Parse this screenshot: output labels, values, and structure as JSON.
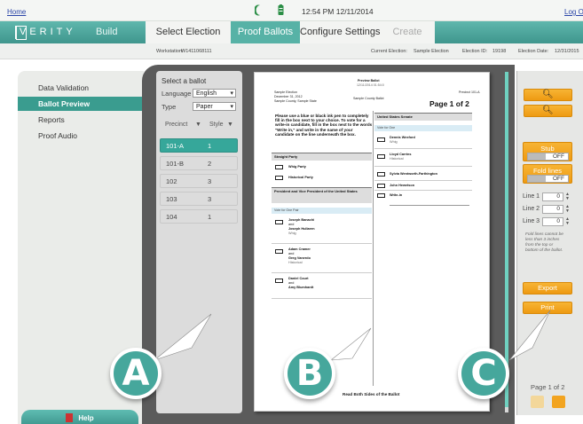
{
  "topbar": {
    "home": "Home",
    "clock": "12:54 PM 12/11/2014",
    "logout": "Log O"
  },
  "nav": {
    "brand": "VERITY",
    "build": "Build",
    "steps": [
      "Select Election",
      "Proof Ballots",
      "Configure Settings",
      "Create"
    ],
    "active_step": "Proof Ballots"
  },
  "info": {
    "workstation_label": "Workstation:",
    "workstation_value": "W1411068111",
    "current_election_label": "Current Election:",
    "current_election_value": "Sample Election",
    "election_id_label": "Election ID:",
    "election_id_value": "19198",
    "election_date_label": "Election Date:",
    "election_date_value": "12/31/2015"
  },
  "sidebar": {
    "items": [
      "Data Validation",
      "Ballot Preview",
      "Reports",
      "Proof Audio"
    ],
    "active": "Ballot Preview",
    "help": "Help"
  },
  "ballot_list": {
    "title": "Select a ballot",
    "language_label": "Language",
    "language_value": "English",
    "type_label": "Type",
    "type_value": "Paper",
    "col_precinct": "Precinct",
    "col_style": "Style",
    "rows": [
      {
        "precinct": "101-A",
        "style": "1"
      },
      {
        "precinct": "101-B",
        "style": "2"
      },
      {
        "precinct": "102",
        "style": "3"
      },
      {
        "precinct": "103",
        "style": "3"
      },
      {
        "precinct": "104",
        "style": "1"
      }
    ],
    "selected_index": 0
  },
  "ballot": {
    "heading": "Preview Ballot",
    "heading_date": "12/11/2014 01:54:0",
    "election_name": "Sample Election",
    "election_date": "December 31, 2012",
    "county_state": "Sample County, Sample State",
    "ballot_name": "Sample County Ballot",
    "precinct": "Precinct 101-A",
    "page_of": "Page 1 of 2",
    "instructions": "Please use a blue or black ink pen to completely fill in the box next to your choice. To vote for a write-in candidate, fill in the box next to the words \"Write in,\" and write in the name of your candidate on the line underneath the box.",
    "straight_party": {
      "title": "Straight Party",
      "choices": [
        "Whig Party",
        "Historical Party"
      ]
    },
    "president": {
      "title": "President and Vice President of the United States",
      "vote_for": "Vote for One Pair",
      "choices": [
        {
          "name": "Joseph Banachi",
          "and": "and",
          "running_mate": "Joseph Hullaren",
          "party": "Whig"
        },
        {
          "name": "Adam Cramer",
          "and": "and",
          "running_mate": "Greg Vanerdo",
          "party": "Historical"
        },
        {
          "name": "Daniel Court",
          "and": "and",
          "running_mate": "Amy Blumhardt",
          "party": ""
        }
      ]
    },
    "senate": {
      "title": "United States Senate",
      "vote_for": "Vote for One",
      "choices": [
        {
          "name": "Dennis Wexford",
          "party": "Whig"
        },
        {
          "name": "Lloyd Carrins",
          "party": "Historical"
        },
        {
          "name": "Sylvia Wentworth-Farthington",
          "party": ""
        },
        {
          "name": "John Hewetson",
          "party": ""
        },
        {
          "name": "Write-in",
          "party": ""
        }
      ]
    },
    "footer": "Read Both Sides of the Ballot"
  },
  "tools": {
    "stub_label": "Stub",
    "stub_state": "OFF",
    "fold_label": "Fold lines",
    "fold_state": "OFF",
    "lines": [
      {
        "label": "Line 1",
        "value": "0"
      },
      {
        "label": "Line 2",
        "value": "0"
      },
      {
        "label": "Line 3",
        "value": "0"
      }
    ],
    "fold_note": "Fold lines cannot be less than 3 inches from the top or bottom of the ballot.",
    "export": "Export",
    "print": "Print",
    "page_count": "Page 1 of 2"
  },
  "callouts": [
    "A",
    "B",
    "C"
  ],
  "colors": {
    "teal": "#3f968d",
    "orange": "#f2a420",
    "dark_panel": "#5b5b5b"
  }
}
